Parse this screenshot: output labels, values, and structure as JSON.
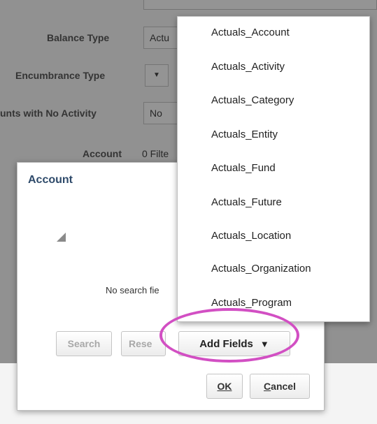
{
  "form": {
    "balance_type_label": "Balance Type",
    "balance_type_value": "Actu",
    "encumbrance_type_label": "Encumbrance Type",
    "encumbrance_dropdown_glyph": "▼",
    "no_activity_label": "unts with No Activity",
    "no_activity_value": "No",
    "account_label": "Account",
    "account_filter_text": "0 Filte"
  },
  "dialog": {
    "title": "Account",
    "empty_message": "No search fie",
    "search_button": "Search",
    "reset_button": "Rese",
    "add_fields_button": "Add Fields",
    "add_fields_caret": "▼",
    "ok_button": "OK",
    "cancel_first_letter": "C",
    "cancel_rest": "ancel"
  },
  "menu": {
    "items": [
      "Actuals_Account",
      "Actuals_Activity",
      "Actuals_Category",
      "Actuals_Entity",
      "Actuals_Fund",
      "Actuals_Future",
      "Actuals_Location",
      "Actuals_Organization",
      "Actuals_Program"
    ]
  },
  "colors": {
    "dialog_title": "#2e4a6a",
    "highlight_ellipse": "#d24fc3",
    "overlay": "rgba(0,0,0,0.42)"
  }
}
